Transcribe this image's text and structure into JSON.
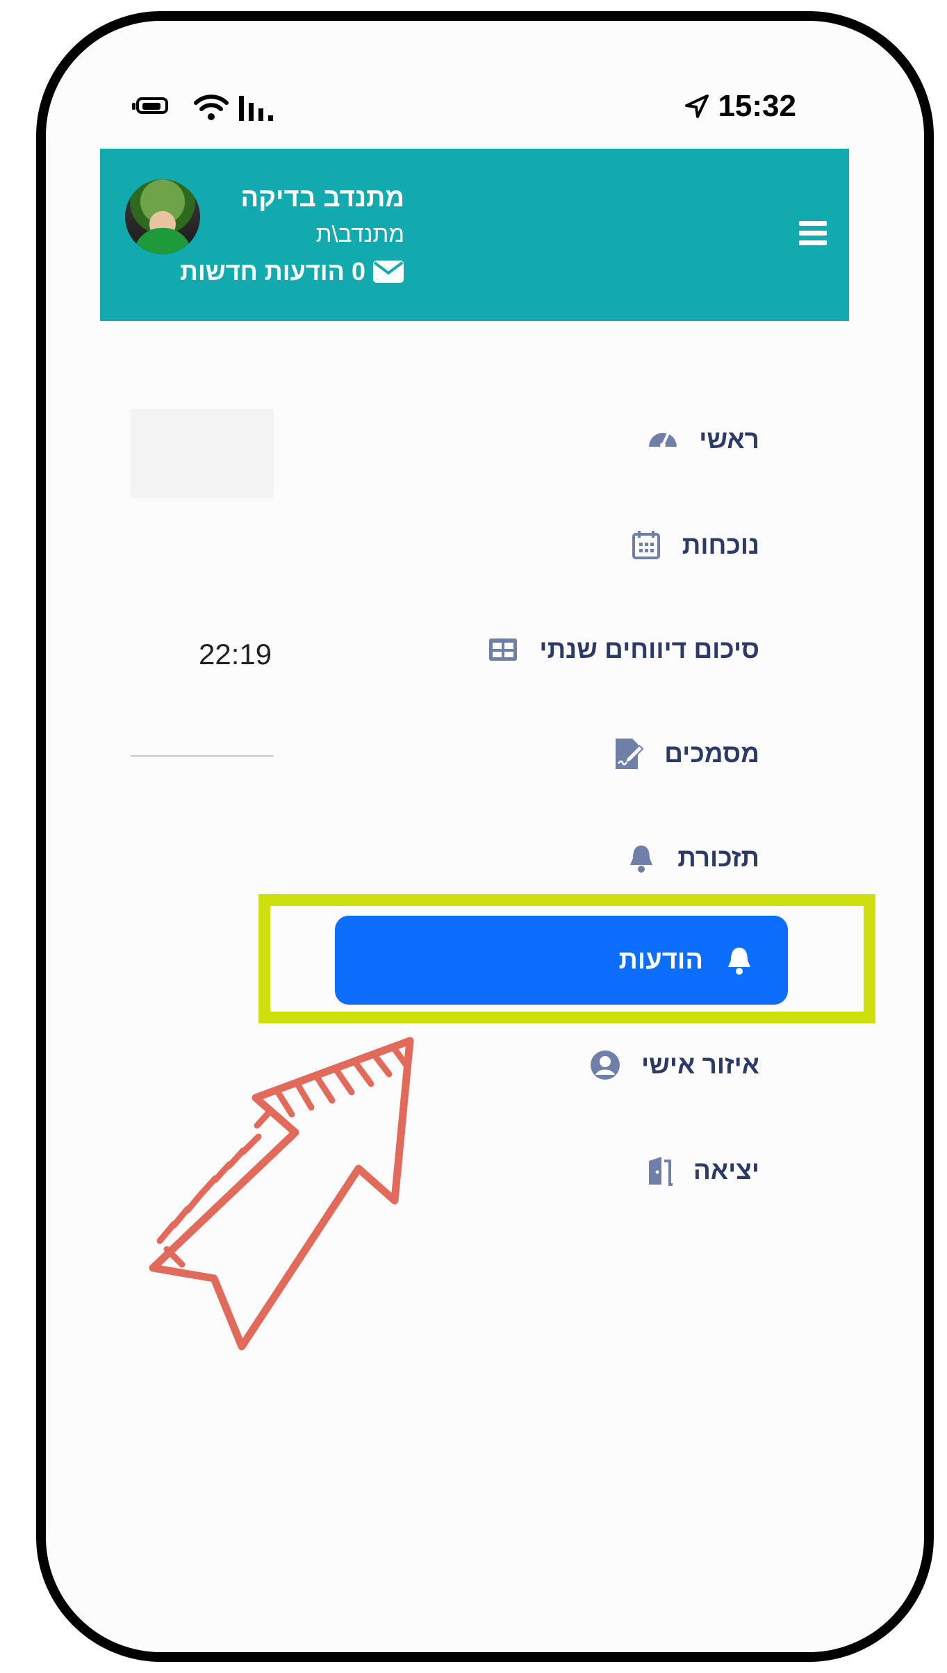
{
  "status_bar": {
    "time": "15:32"
  },
  "header": {
    "user_name": "מתנדב בדיקה",
    "user_role": "מתנדב\\ת",
    "messages_count": "0",
    "messages_label": "הודעות חדשות"
  },
  "menu": {
    "items": [
      {
        "label": "ראשי",
        "icon": "dashboard-icon"
      },
      {
        "label": "נוכחות",
        "icon": "calendar-icon"
      },
      {
        "label": "סיכום דיווחים שנתי",
        "icon": "table-icon"
      },
      {
        "label": "מסמכים",
        "icon": "document-sign-icon"
      },
      {
        "label": "תזכורת",
        "icon": "bell-icon"
      },
      {
        "label": "הודעות",
        "icon": "bell-icon",
        "active": true
      },
      {
        "label": "איזור אישי",
        "icon": "user-circle-icon"
      },
      {
        "label": "יציאה",
        "icon": "door-exit-icon"
      }
    ]
  },
  "background": {
    "time": "22:19"
  },
  "colors": {
    "header": "#11aaaf",
    "active": "#0d6efd",
    "menu_text": "#2b3a67",
    "highlight": "#cde00d",
    "annotation_arrow": "#e26a5a"
  }
}
